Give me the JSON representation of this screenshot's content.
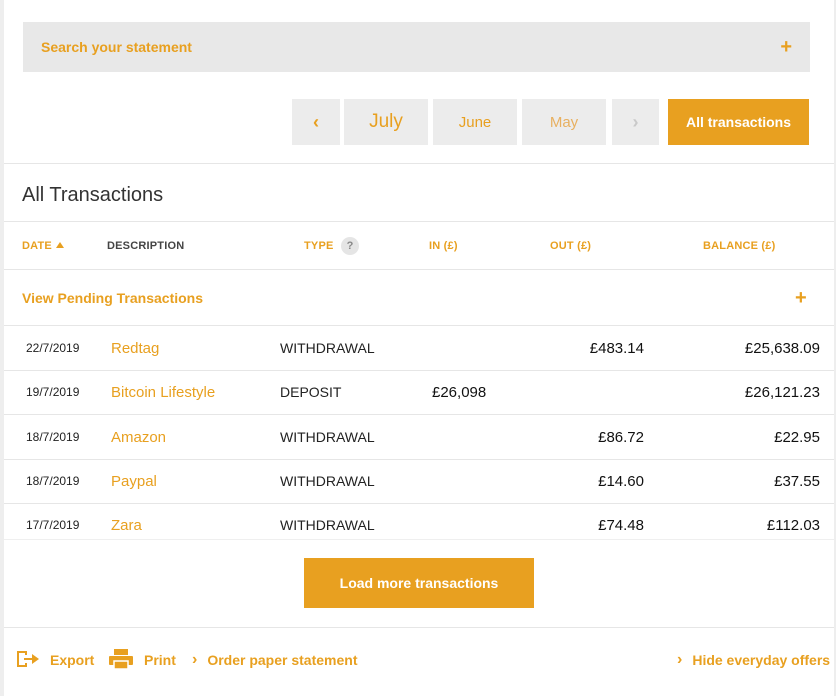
{
  "search": {
    "label": "Search your statement",
    "expand_icon": "+"
  },
  "month_nav": {
    "prev_icon": "‹",
    "months": [
      "July",
      "June",
      "May"
    ],
    "next_icon": "›",
    "all_label": "All transactions"
  },
  "section_title": "All Transactions",
  "table": {
    "headers": {
      "date": "DATE",
      "description": "DESCRIPTION",
      "type": "TYPE",
      "type_help": "?",
      "in": "IN (£)",
      "out": "OUT (£)",
      "balance": "BALANCE (£)"
    },
    "pending_label": "View Pending Transactions",
    "pending_icon": "+",
    "rows": [
      {
        "date": "22/7/2019",
        "description": "Redtag",
        "type": "WITHDRAWAL",
        "in": "",
        "out": "£483.14",
        "balance": "£25,638.09"
      },
      {
        "date": "19/7/2019",
        "description": "Bitcoin Lifestyle",
        "type": "DEPOSIT",
        "in": "£26,098",
        "out": "",
        "balance": "£26,121.23"
      },
      {
        "date": "18/7/2019",
        "description": "Amazon",
        "type": "WITHDRAWAL",
        "in": "",
        "out": "£86.72",
        "balance": "£22.95"
      },
      {
        "date": "18/7/2019",
        "description": "Paypal",
        "type": "WITHDRAWAL",
        "in": "",
        "out": "£14.60",
        "balance": "£37.55"
      },
      {
        "date": "17/7/2019",
        "description": "Zara",
        "type": "WITHDRAWAL",
        "in": "",
        "out": "£74.48",
        "balance": "£112.03"
      }
    ]
  },
  "load_more_label": "Load more transactions",
  "footer": {
    "export_label": "Export",
    "print_label": "Print",
    "order_label": "Order paper statement",
    "hide_label": "Hide everyday offers",
    "chevron": "›"
  },
  "colors": {
    "accent": "#e8a020",
    "panel": "#e8e8e8",
    "text": "#222222"
  }
}
